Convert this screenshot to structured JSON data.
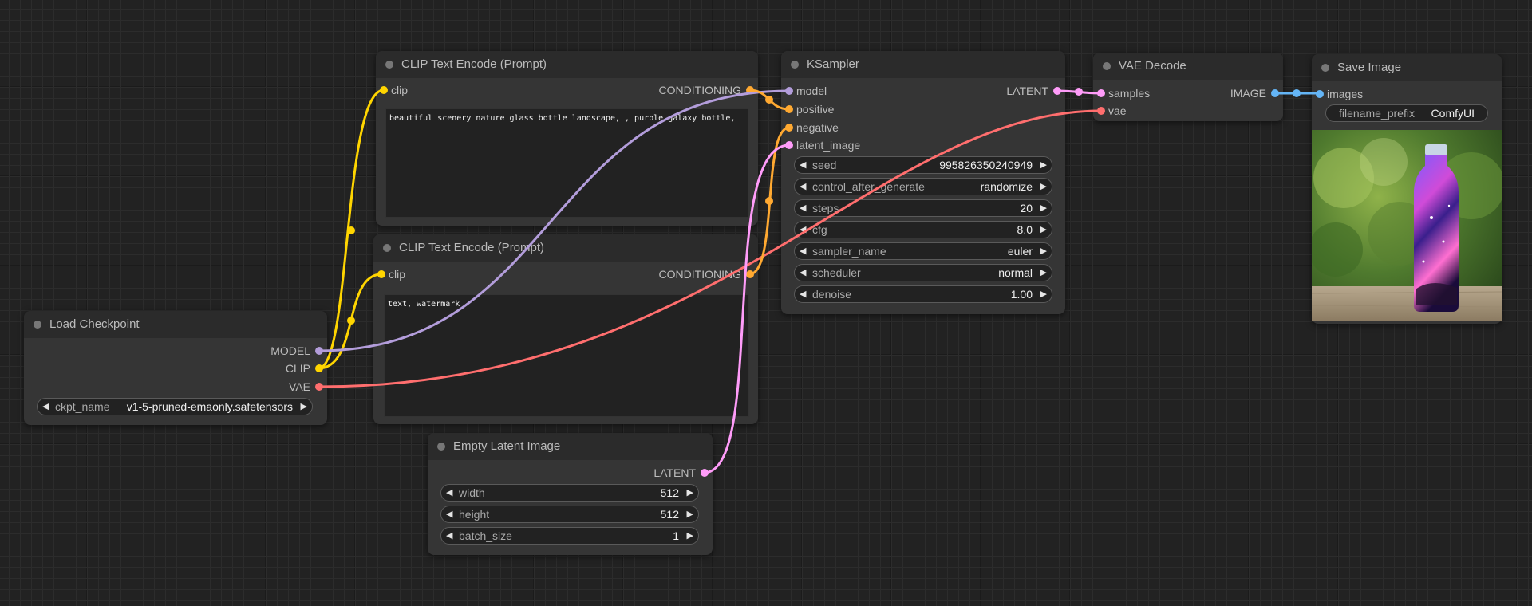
{
  "nodes": {
    "clip_pos": {
      "title": "CLIP Text Encode (Prompt)",
      "input_clip": "clip",
      "output": "CONDITIONING",
      "text": "beautiful scenery nature glass bottle landscape, , purple galaxy bottle,"
    },
    "clip_neg": {
      "title": "CLIP Text Encode (Prompt)",
      "input_clip": "clip",
      "output": "CONDITIONING",
      "text": "text, watermark"
    },
    "ksampler": {
      "title": "KSampler",
      "inputs": [
        "model",
        "positive",
        "negative",
        "latent_image"
      ],
      "output": "LATENT",
      "widgets": [
        {
          "name": "seed",
          "value": "995826350240949"
        },
        {
          "name": "control_after_generate",
          "value": "randomize"
        },
        {
          "name": "steps",
          "value": "20"
        },
        {
          "name": "cfg",
          "value": "8.0"
        },
        {
          "name": "sampler_name",
          "value": "euler"
        },
        {
          "name": "scheduler",
          "value": "normal"
        },
        {
          "name": "denoise",
          "value": "1.00"
        }
      ]
    },
    "vae_decode": {
      "title": "VAE Decode",
      "inputs": [
        "samples",
        "vae"
      ],
      "output": "IMAGE"
    },
    "save_image": {
      "title": "Save Image",
      "input": "images",
      "widget": {
        "name": "filename_prefix",
        "value": "ComfyUI"
      }
    },
    "load_checkpoint": {
      "title": "Load Checkpoint",
      "outputs": [
        "MODEL",
        "CLIP",
        "VAE"
      ],
      "widget": {
        "name": "ckpt_name",
        "value": "v1-5-pruned-emaonly.safetensors"
      }
    },
    "empty_latent": {
      "title": "Empty Latent Image",
      "output": "LATENT",
      "widgets": [
        {
          "name": "width",
          "value": "512"
        },
        {
          "name": "height",
          "value": "512"
        },
        {
          "name": "batch_size",
          "value": "1"
        }
      ]
    }
  },
  "colors": {
    "clip": "#ffd500",
    "model": "#b39ddb",
    "vae": "#ff6e6e",
    "conditioning": "#ffa931",
    "latent": "#ff9cf9",
    "image": "#64b5f6"
  }
}
